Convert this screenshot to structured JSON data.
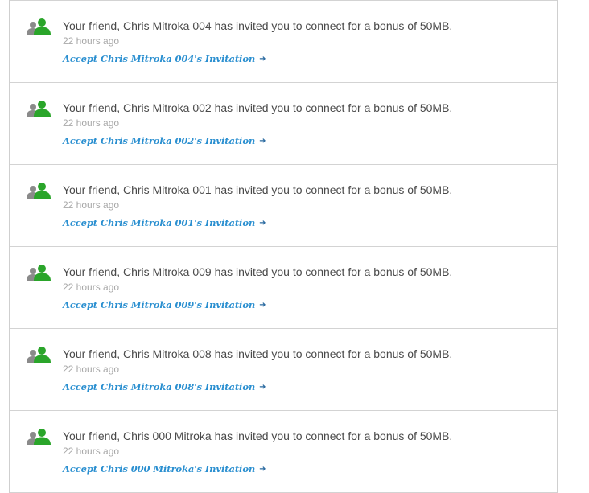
{
  "invitations": [
    {
      "message": "Your friend, Chris Mitroka 004 has invited you to connect for a bonus of 50MB.",
      "time": "22 hours ago",
      "link": "Accept Chris Mitroka 004's Invitation"
    },
    {
      "message": "Your friend, Chris Mitroka 002 has invited you to connect for a bonus of 50MB.",
      "time": "22 hours ago",
      "link": "Accept Chris Mitroka 002's Invitation"
    },
    {
      "message": "Your friend, Chris Mitroka 001 has invited you to connect for a bonus of 50MB.",
      "time": "22 hours ago",
      "link": "Accept Chris Mitroka 001's Invitation"
    },
    {
      "message": "Your friend, Chris Mitroka 009 has invited you to connect for a bonus of 50MB.",
      "time": "22 hours ago",
      "link": "Accept Chris Mitroka 009's Invitation"
    },
    {
      "message": "Your friend, Chris Mitroka 008 has invited you to connect for a bonus of 50MB.",
      "time": "22 hours ago",
      "link": "Accept Chris Mitroka 008's Invitation"
    },
    {
      "message": "Your friend, Chris 000 Mitroka has invited you to connect for a bonus of 50MB.",
      "time": "22 hours ago",
      "link": "Accept Chris 000 Mitroka's Invitation"
    }
  ],
  "icons": {
    "friends": "friends-icon",
    "arrow": "arrow-right-icon"
  },
  "colors": {
    "icon_front": "#2aa52a",
    "icon_back": "#8a8a8a",
    "link": "#2a8fd0",
    "message": "#4a4a4a",
    "time": "#a8a8a8",
    "border": "#d3d3d3"
  }
}
